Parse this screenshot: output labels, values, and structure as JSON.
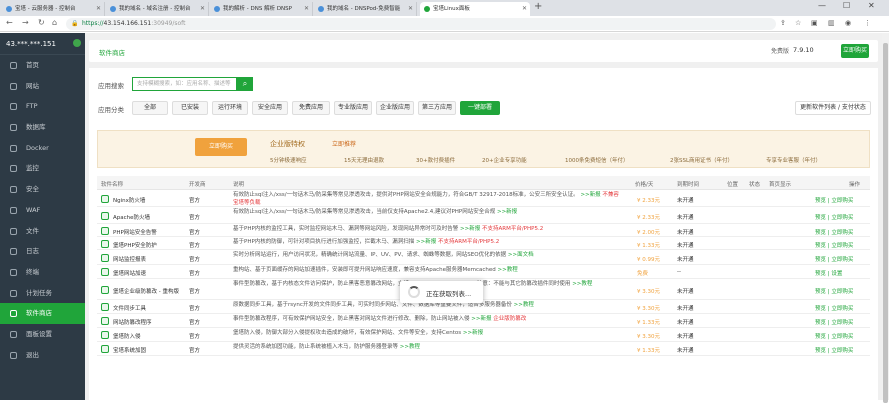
{
  "tabs": [
    {
      "label": "宝塔 - 云服务器 - 控制台"
    },
    {
      "label": "我的域名 - 域名注册 - 控制台"
    },
    {
      "label": "我的解析 - DNS 解析 DNSP"
    },
    {
      "label": "我的域名 - DNSPod-免费智能"
    },
    {
      "label": "宝塔Linux面板"
    }
  ],
  "address": {
    "scheme": "https://",
    "host": "43.154.166.151",
    "path": ":30949/soft"
  },
  "sidebar": {
    "ip": "43.***.***.151",
    "items": [
      {
        "label": "首页"
      },
      {
        "label": "网站"
      },
      {
        "label": "FTP"
      },
      {
        "label": "数据库"
      },
      {
        "label": "Docker"
      },
      {
        "label": "监控"
      },
      {
        "label": "安全"
      },
      {
        "label": "WAF"
      },
      {
        "label": "文件"
      },
      {
        "label": "日志"
      },
      {
        "label": "终端"
      },
      {
        "label": "计划任务"
      },
      {
        "label": "软件商店"
      },
      {
        "label": "面板设置"
      },
      {
        "label": "退出"
      }
    ]
  },
  "header": {
    "title": "软件商店",
    "free": "免费版",
    "version": "7.9.10",
    "buy": "立即购买"
  },
  "search": {
    "label": "应用搜索",
    "placeholder": "支持模糊搜索，如：应用名称、描述等"
  },
  "categories": {
    "label": "应用分类",
    "items": [
      "全部",
      "已安装",
      "运行环境",
      "安全应用",
      "免费应用",
      "专业版应用",
      "企业版应用",
      "第三方应用",
      "一键部署"
    ],
    "update": "更新软件列表 / 支付状态"
  },
  "banner": {
    "buy": "立即购买",
    "enterprise": "企业版特权",
    "recommend": "立即推荐",
    "features": [
      "5分钟极速响应",
      "15天无理由退款",
      "30+款付费插件",
      "20+企业专享功能",
      "1000条免费短信（年付）",
      "2张SSL商用证书（年付）",
      "专享专业客服（年付）"
    ]
  },
  "table": {
    "headers": [
      "软件名称",
      "开发商",
      "说明",
      "价格/天",
      "到期时间",
      "位置",
      "状态",
      "首页显示",
      "操作"
    ],
    "rows": [
      {
        "name": "Nginx防火墙",
        "dev": "官方",
        "desc": "有效防止sql注入/xss/一句话木马/防采集等常见渗透攻击，提供对PHP网站安全合规能力，符合GB/T 32917-2018标准，公安三所安全认证。",
        "tag": ">>新报",
        "tag2": "不兼容宝塔等负载",
        "price": "¥ 2.33元",
        "expire": "未开通",
        "act": "预览 | 立即购买"
      },
      {
        "name": "Apache防火墙",
        "dev": "官方",
        "desc": "有效防止sql注入/xss/一句话木马/防采集等常见渗透攻击，当前仅支持Apache2.4,建议对PHP网站安全合规",
        "tag": ">>新报",
        "tag2": "",
        "price": "¥ 2.33元",
        "expire": "未开通",
        "act": "预览 | 立即购买"
      },
      {
        "name": "PHP网站安全告警",
        "dev": "官方",
        "desc": "基于PHP内核的监控工具，实时监控网站木马、漏洞等网站风险，发现网站异常时可及时告警",
        "tag": ">>新报",
        "tag2": "不支持ARM平台/PHP5.2",
        "price": "¥ 2.00元",
        "expire": "未开通",
        "act": "预览 | 立即购买"
      },
      {
        "name": "堡塔PHP安全防护",
        "dev": "官方",
        "desc": "基于PHP内核的防御，可针对项目执行进行加强监控，拦截木马、漏洞扫描",
        "tag": ">>新报",
        "tag2": "不支持ARM平台/PHP5.2",
        "price": "¥ 1.33元",
        "expire": "未开通",
        "act": "预览 | 立即购买"
      },
      {
        "name": "网站监控报表",
        "dev": "官方",
        "desc": "实时分析网站运行，用户访问状况，精确统计网站流量、IP、UV、PV、请求、蜘蛛等数据，网站SEO优化的依据",
        "tag": ">>面文档",
        "tag2": "",
        "price": "¥ 0.99元",
        "expire": "未开通",
        "act": "预览 | 立即购买"
      },
      {
        "name": "堡塔网站加速",
        "dev": "官方",
        "desc": "重构站、基于页面缓存的网站加速插件，安装即可提升网站响应速度，兼容支持Apache服务器Memcached",
        "tag": ">>教程",
        "tag2": "",
        "price": "免费",
        "expire": "--",
        "act": "预览 | 设置"
      },
      {
        "name": "堡塔企业级防篡改 - 重构版",
        "dev": "官方",
        "desc": "事件型防篡改，基于内核态文件访问保护，防止黑客恶意篡改网站，支持Centos/Debian/Ubuntu，注意：不能与其它防篡改插件同时使用",
        "tag": ">>教程",
        "tag2": "",
        "price": "¥ 3.30元",
        "expire": "未开通",
        "act": "预览 | 立即购买"
      },
      {
        "name": "文件同步工具",
        "dev": "官方",
        "desc": "原数据同步工具，基于rsync开发的文件同步工具，可实时同步网站、文件、数据库等重要文件，适合多服务器备份",
        "tag": ">>教程",
        "tag2": "",
        "price": "¥ 3.30元",
        "expire": "未开通",
        "act": "预览 | 立即购买"
      },
      {
        "name": "网站防篡改程序",
        "dev": "官方",
        "desc": "事件型防篡改程序，可有效保护网站安全，防止黑客对网站文件进行修改、删除，防止网站被入侵",
        "tag": ">>新报",
        "tag2": "企业版防篡改",
        "price": "¥ 1.33元",
        "expire": "未开通",
        "act": "预览 | 立即购买"
      },
      {
        "name": "堡塔防入侵",
        "dev": "官方",
        "desc": "堡塔防入侵，防御大部分入侵提权攻击造成的破坏，有效保护网站、文件等安全，支持Centos",
        "tag": ">>新报",
        "tag2": "",
        "price": "¥ 3.30元",
        "expire": "未开通",
        "act": "预览 | 立即购买"
      },
      {
        "name": "宝塔系统加固",
        "dev": "官方",
        "desc": "提供灵活的系统加固功能，防止系统被植入木马，防护服务器登录等",
        "tag": ">>教程",
        "tag2": "",
        "price": "¥ 1.33元",
        "expire": "未开通",
        "act": "预览 | 立即购买"
      }
    ]
  },
  "loading": {
    "text": "正在获取列表..."
  }
}
